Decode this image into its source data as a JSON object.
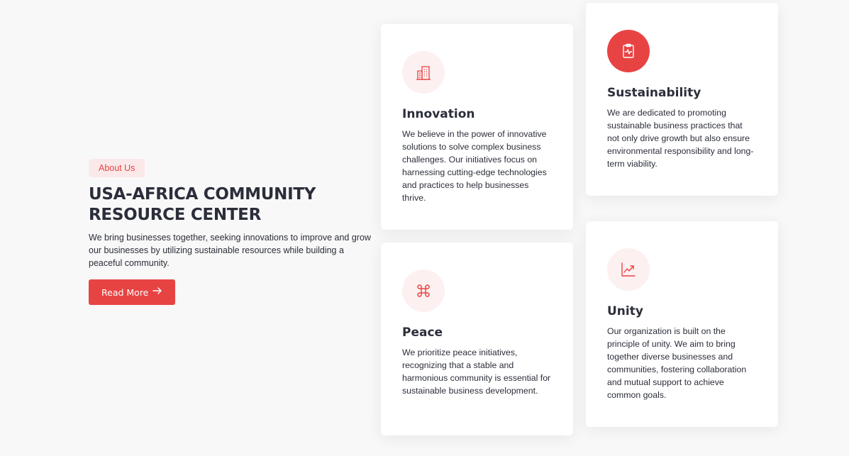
{
  "intro": {
    "badge": "About Us",
    "title_line1": "USA-AFRICA COMMUNITY",
    "title_line2": "RESOURCE CENTER",
    "description": "We bring businesses together, seeking innovations to improve and grow our businesses by utilizing sustainable resources while building a peaceful community.",
    "button_label": "Read More",
    "button_icon": "arrow-right-icon"
  },
  "cards": {
    "innovation": {
      "icon": "building-icon",
      "title": "Innovation",
      "text": "We believe in the power of innovative solutions to solve complex business challenges. Our initiatives focus on harnessing cutting-edge technologies and practices to help businesses thrive."
    },
    "sustainability": {
      "icon": "clipboard-pulse-icon",
      "title": "Sustainability",
      "text": "We are dedicated to promoting sustainable business practices that not only drive growth but also ensure environmental responsibility and long-term viability."
    },
    "peace": {
      "icon": "command-icon",
      "title": "Peace",
      "text": "We prioritize peace initiatives, recognizing that a stable and harmonious community is essential for sustainable business development."
    },
    "unity": {
      "icon": "trending-up-icon",
      "title": "Unity",
      "text": "Our organization is built on the principle of unity. We aim to bring together diverse businesses and communities, fostering collaboration and mutual support to achieve common goals."
    }
  },
  "colors": {
    "accent": "#e84343",
    "accent_soft": "#fdf0f0",
    "text": "#2b2e3a",
    "background": "#f8f8f8"
  }
}
